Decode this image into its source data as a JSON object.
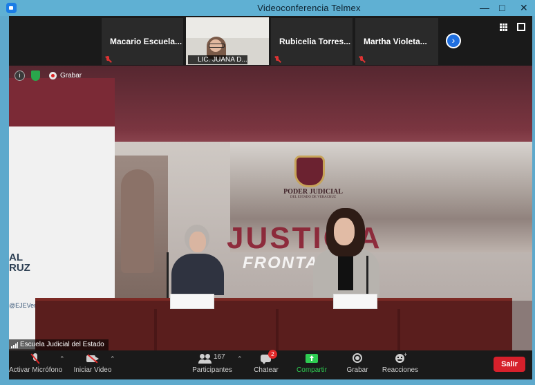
{
  "window": {
    "title": "Videoconferencia Telmex",
    "controls": [
      "minimize-icon",
      "maximize-icon",
      "close-icon"
    ]
  },
  "participants_strip": {
    "tiles": [
      {
        "name": "Macario  Escuela...",
        "muted": true
      },
      {
        "name": "LIC. JUANA D...",
        "muted": true,
        "video": true
      },
      {
        "name": "Rubicelia  Torres...",
        "muted": true
      },
      {
        "name": "Martha  Violeta...",
        "muted": true
      }
    ],
    "next_icon": "chevron-right-icon",
    "grid_icon": "grid-view-icon",
    "fullscreen_icon": "fullscreen-icon"
  },
  "indicators": {
    "info_icon": "info-icon",
    "security_icon": "shield-check-icon",
    "recording_label": "Grabar"
  },
  "scene": {
    "backdrop_brand": "PODER JUDICIAL",
    "backdrop_sub": "DEL ESTADO DE VERACRUZ",
    "big_word": "JUSTICIA",
    "sub_word": "FRONTAL Y",
    "banner_text_line1": "AL",
    "banner_text_line2": "RUZ",
    "banner_handle": "@EJEVera",
    "speaker_name": "Escuela Judicial del Estado"
  },
  "toolbar": {
    "mic_label": "Activar Micrófono",
    "video_label": "Iniciar Video",
    "participants_label": "Participantes",
    "participants_count": "167",
    "chat_label": "Chatear",
    "chat_badge": "2",
    "share_label": "Compartir",
    "record_label": "Grabar",
    "reactions_label": "Reacciones",
    "leave_label": "Salir",
    "colors": {
      "share": "#2ecc52",
      "leave": "#d6202b",
      "badge": "#e02828"
    }
  }
}
